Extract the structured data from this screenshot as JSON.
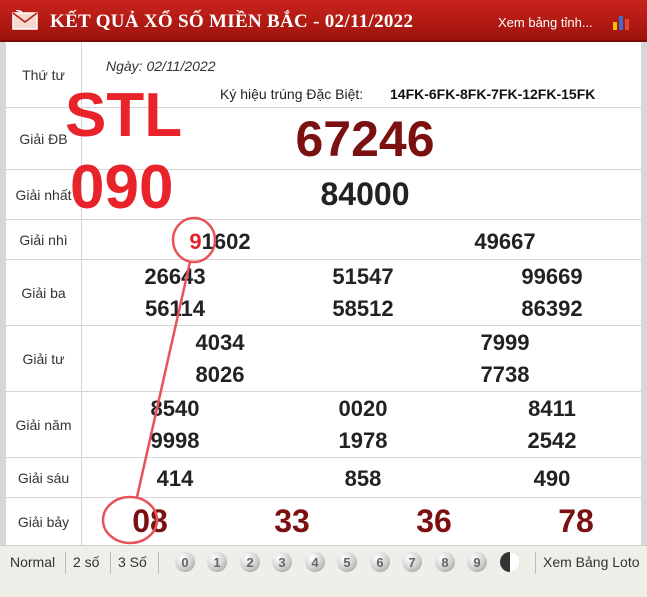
{
  "header": {
    "title": "KẾT QUẢ XỔ SỐ MIỀN BẮC - 02/11/2022",
    "view_link": "Xem bảng tỉnh..."
  },
  "info": {
    "day": "Thứ tư",
    "date": "Ngày: 02/11/2022",
    "symbol_label": "Ký hiệu trúng Đặc Biệt:",
    "symbol_value": "14FK-6FK-8FK-7FK-12FK-15FK"
  },
  "prizes": {
    "db": {
      "label": "Giải ĐB",
      "values": [
        "67246"
      ]
    },
    "g1": {
      "label": "Giải nhất",
      "values": [
        "84000"
      ]
    },
    "g2": {
      "label": "Giải nhì",
      "values": [
        "91602",
        "49667"
      ],
      "highlight_digit": "9",
      "highlight_rest": "1602"
    },
    "g3": {
      "label": "Giải ba",
      "values": [
        "26643",
        "51547",
        "99669",
        "56114",
        "58512",
        "86392"
      ]
    },
    "g4": {
      "label": "Giải tư",
      "values": [
        "4034",
        "7999",
        "8026",
        "7738"
      ]
    },
    "g5": {
      "label": "Giải năm",
      "values": [
        "8540",
        "0020",
        "8411",
        "9998",
        "1978",
        "2542"
      ]
    },
    "g6": {
      "label": "Giải sáu",
      "values": [
        "414",
        "858",
        "490"
      ]
    },
    "g7": {
      "label": "Giải bảy",
      "values": [
        "08",
        "33",
        "36",
        "78"
      ]
    }
  },
  "annotation": {
    "line1": "STL",
    "line2": "090",
    "color": "#e8232a"
  },
  "footer": {
    "tabs": [
      "Normal",
      "2 số",
      "3 Số"
    ],
    "digits": [
      "0",
      "1",
      "2",
      "3",
      "4",
      "5",
      "6",
      "7",
      "8",
      "9"
    ],
    "loto_link": "Xem Bảng Loto"
  }
}
